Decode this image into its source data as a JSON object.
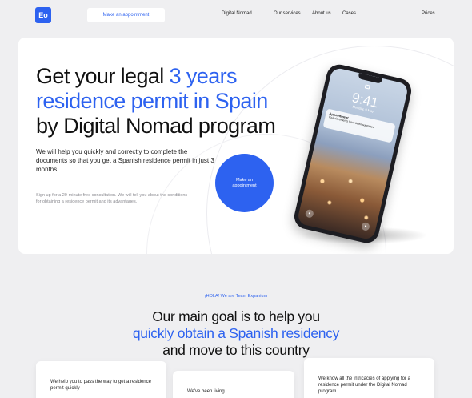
{
  "header": {
    "logo": "Eo",
    "cta_label": "Make an appointment",
    "nav": [
      "Digital Nomad",
      "Our services",
      "About us",
      "Cases"
    ],
    "prices": "Prices"
  },
  "hero": {
    "title_line1_dark": "Get your legal ",
    "title_line1_blue": "3 years",
    "title_line2_blue": "residence permit in Spain",
    "title_line3_dark": "by Digital Nomad program",
    "description": "We will help you quickly and correctly to complete the documents so that you get a Spanish residence permit in just 3 months.",
    "note": "Sign up for a 20-minute free consultation. We will tell you about the conditions for obtaining a residence permit and its advantages.",
    "cta_label": "Make an appointment",
    "phone": {
      "time": "9:41",
      "date": "Monday, 9 May",
      "notif_title": "Appointment",
      "notif_text": "Your documents have been submitted"
    }
  },
  "goal": {
    "eyebrow": "¡HOLA! We are Team Expanium",
    "line1": "Our main goal is to help you",
    "line2_blue": "quickly obtain a Spanish residency",
    "line3": "and move to this country"
  },
  "cards": [
    {
      "text": "We help you to pass the way to get a residence permit quickly"
    },
    {
      "text": "We've been living"
    },
    {
      "text": "We know all the intricacies of applying for a residence permit under the Digital Nomad program"
    }
  ],
  "colors": {
    "accent": "#2d62f0",
    "background": "#efeff1",
    "card": "#ffffff"
  }
}
